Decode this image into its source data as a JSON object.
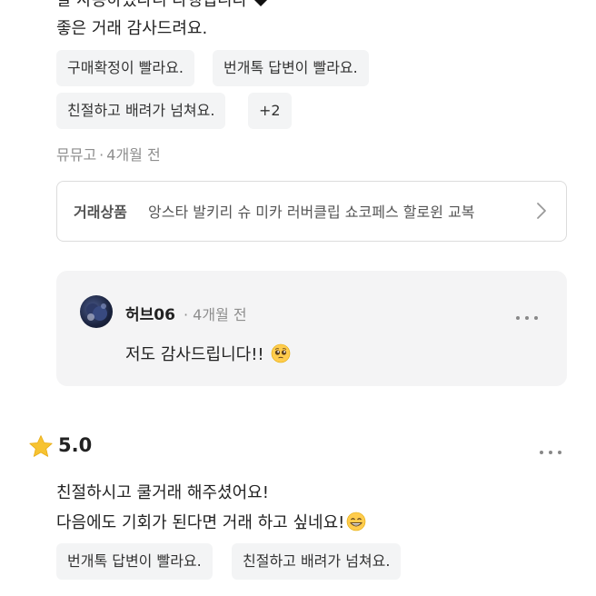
{
  "review1": {
    "cut_text": "잘 사용하셨다니 다행입니다",
    "text": "좋은 거래 감사드려요.",
    "tags": [
      "구매확정이 빨라요.",
      "번개톡 답변이 빨라요.",
      "친절하고 배려가 넘쳐요.",
      "+2"
    ],
    "author": "뮤뮤고",
    "time": "4개월 전",
    "product": {
      "label": "거래상품",
      "name": "앙스타 발키리 슈 미카 러버클립 쇼코페스 할로윈 교복"
    },
    "reply": {
      "name": "허브06",
      "time": "4개월 전",
      "text": "저도 감사드립니다!!",
      "emoji": "pleading-face-emoji"
    }
  },
  "review2": {
    "rating": "5.0",
    "line1": "친절하시고 쿨거래 해주셨어요!",
    "line2": "다음에도 기회가 된다면 거래 하고 싶네요!",
    "emoji": "grinning-face-emoji",
    "tags": [
      "번개톡 답변이 빨라요.",
      "친절하고 배려가 넘쳐요."
    ]
  },
  "colors": {
    "tag_bg": "#f3f4f5",
    "reply_bg": "#f4f4f5",
    "star": "#f7c331",
    "meta_text": "#8e8e8e"
  },
  "icons": [
    "more-icon",
    "chevron-right-icon",
    "star-icon",
    "avatar-image"
  ]
}
